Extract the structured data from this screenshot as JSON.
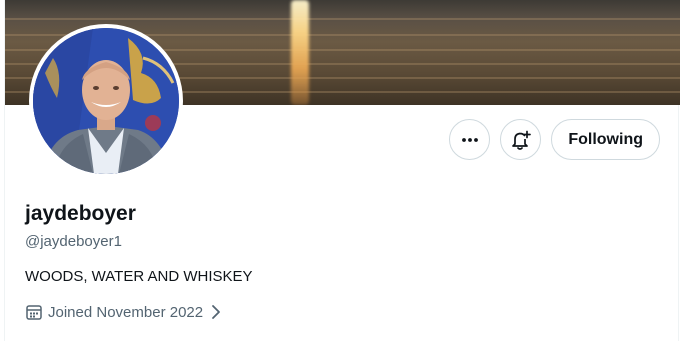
{
  "profile": {
    "display_name": "jaydeboyer",
    "handle": "@jaydeboyer1",
    "bio": "WOODS, WATER AND WHISKEY",
    "joined": "Joined November 2022"
  },
  "actions": {
    "more_icon": "more-icon",
    "notify_icon": "bell-plus-icon",
    "following_label": "Following"
  },
  "colors": {
    "text_primary": "#0f1419",
    "text_secondary": "#536471",
    "border": "#cfd9de"
  }
}
